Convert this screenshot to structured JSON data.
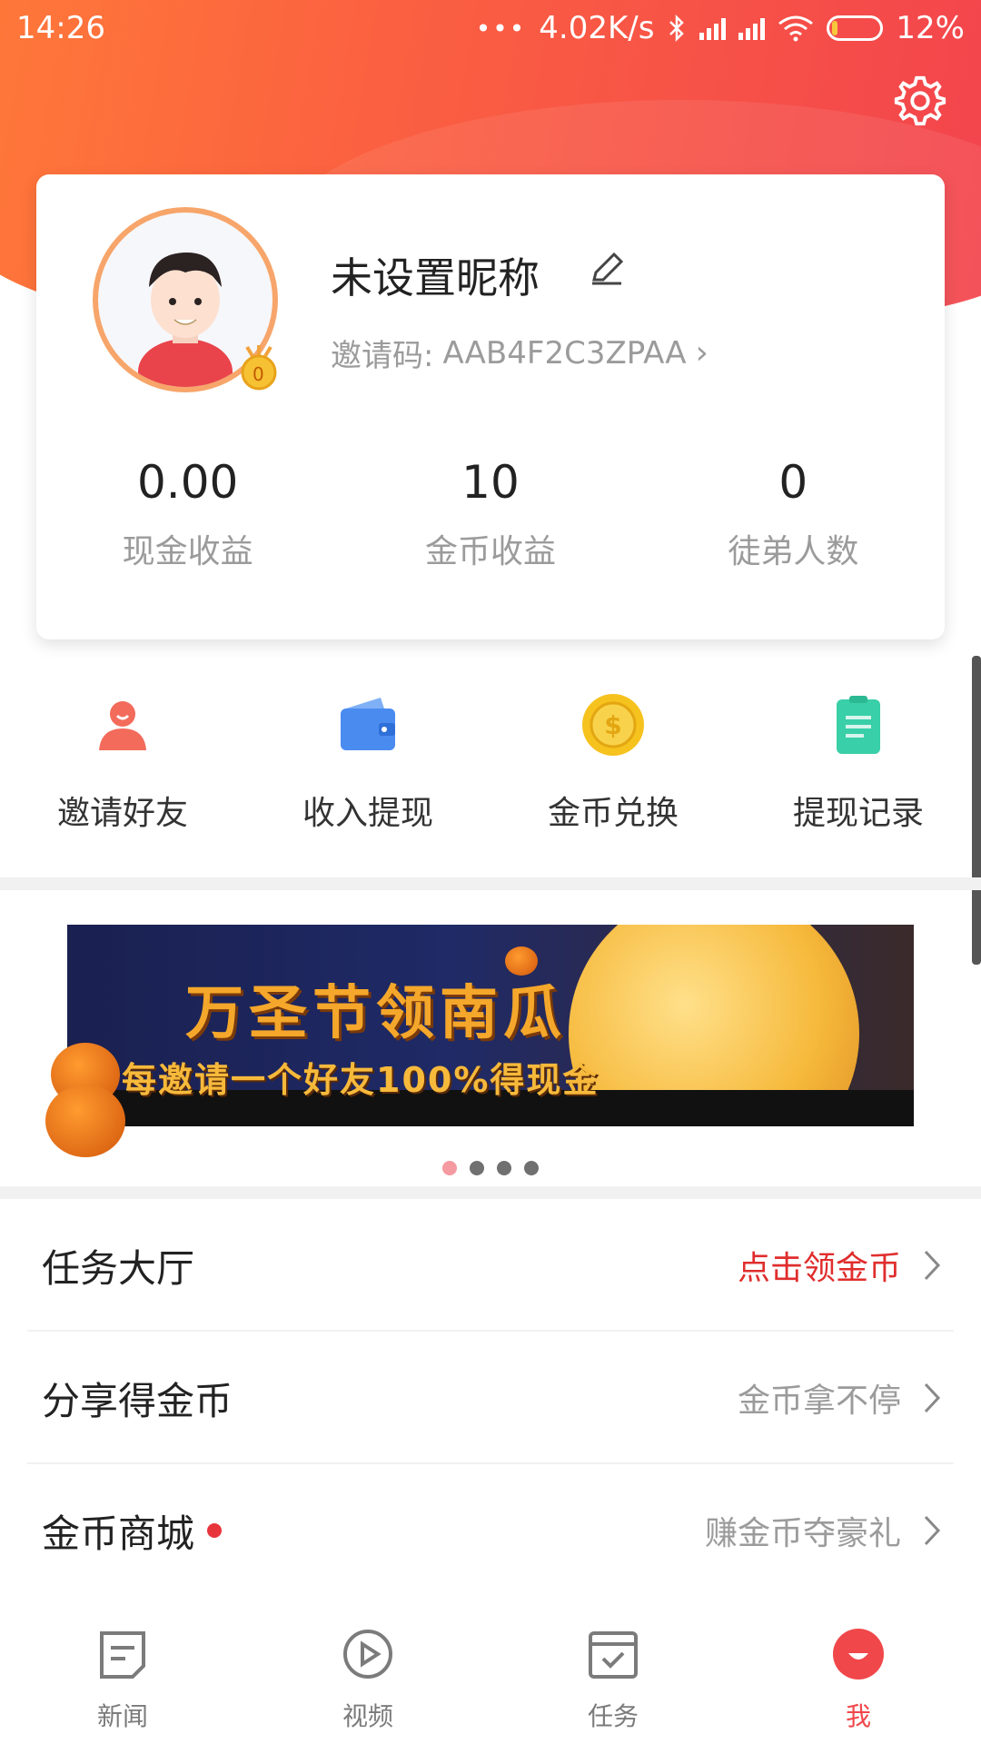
{
  "status_bar": {
    "time": "14:26",
    "dots": "•••",
    "net_speed": "4.02K/s",
    "battery": "12%",
    "battery_level": 0.12
  },
  "profile": {
    "nickname": "未设置昵称",
    "invite_label": "邀请码:",
    "invite_code": "AAB4F2C3ZPAA",
    "invite_chevron": "›",
    "level": "0"
  },
  "stats": [
    {
      "value": "0.00",
      "label": "现金收益"
    },
    {
      "value": "10",
      "label": "金币收益"
    },
    {
      "value": "0",
      "label": "徒弟人数"
    }
  ],
  "quick_actions": [
    {
      "label": "邀请好友",
      "icon": "person-icon",
      "color": "#f36b5b"
    },
    {
      "label": "收入提现",
      "icon": "wallet-icon",
      "color": "#4a8bf0"
    },
    {
      "label": "金币兑换",
      "icon": "coin-icon",
      "color": "#f6c21d"
    },
    {
      "label": "提现记录",
      "icon": "clipboard-icon",
      "color": "#39cfa8"
    }
  ],
  "banner": {
    "title": "万圣节领南瓜",
    "subtitle": "每邀请一个好友100%得现金",
    "page_count": 4,
    "active_index": 0
  },
  "list": [
    {
      "title": "任务大厅",
      "hint": "点击领金币",
      "hint_red": true,
      "dot": false
    },
    {
      "title": "分享得金币",
      "hint": "金币拿不停",
      "hint_red": false,
      "dot": false
    },
    {
      "title": "金币商城",
      "hint": "赚金币夺豪礼",
      "hint_red": false,
      "dot": true
    }
  ],
  "tabs": [
    {
      "label": "新闻",
      "icon": "news-icon",
      "active": false
    },
    {
      "label": "视频",
      "icon": "video-icon",
      "active": false
    },
    {
      "label": "任务",
      "icon": "task-icon",
      "active": false
    },
    {
      "label": "我",
      "icon": "me-icon",
      "active": true
    }
  ],
  "colors": {
    "accent": "#f0474a",
    "hero_start": "#ff7a38",
    "hero_end": "#f2424e"
  }
}
